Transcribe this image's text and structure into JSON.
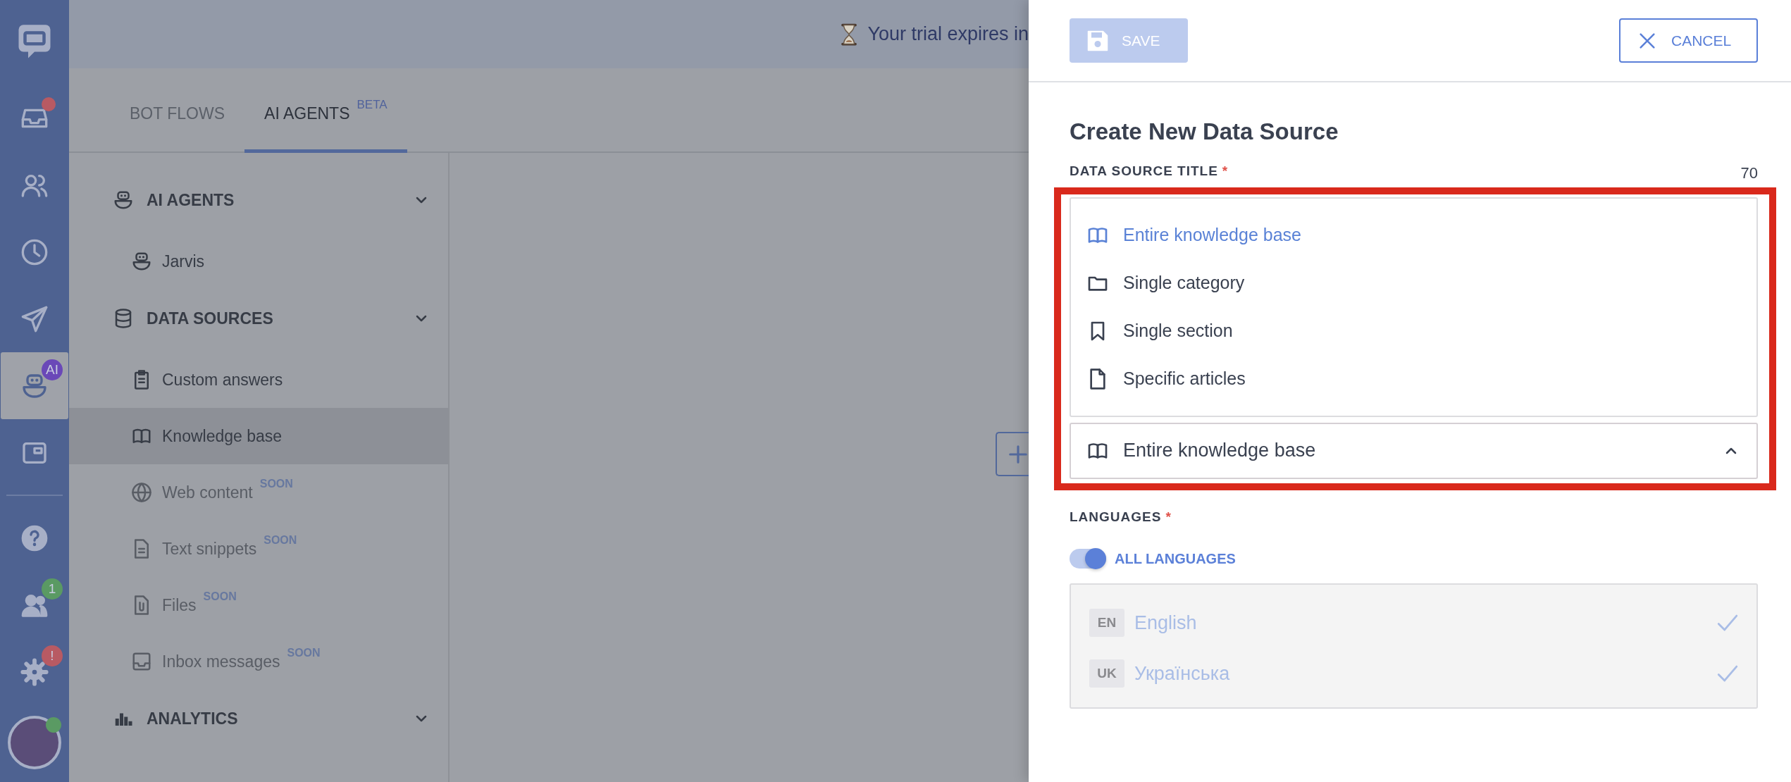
{
  "rail": {
    "top": [
      {
        "selected": false,
        "badge": {
          "color": "#b85a63"
        }
      },
      {
        "selected": false
      },
      {
        "selected": false
      },
      {
        "selected": false
      },
      {
        "selected": true,
        "badge": {
          "text": "AI",
          "color": "#6a48b8"
        }
      },
      {
        "selected": false
      }
    ],
    "bottom": [
      {
        "selected": false
      },
      {
        "selected": false,
        "badge": {
          "text": "1",
          "color": "#5a9a63"
        }
      },
      {
        "selected": false,
        "badge": {
          "text": "!",
          "color": "#b85a63"
        }
      }
    ],
    "avatar": {
      "online": true
    }
  },
  "top_bar": {
    "trial_text": "Your trial expires in"
  },
  "tabs": [
    {
      "label": "BOT FLOWS",
      "selected": false
    },
    {
      "label": "AI AGENTS",
      "badge": "BETA",
      "selected": true
    }
  ],
  "nav": {
    "sections": [
      {
        "title": "AI AGENTS",
        "items": [
          {
            "label": "Jarvis",
            "selected": false,
            "disabled": false
          }
        ]
      },
      {
        "title": "DATA SOURCES",
        "items": [
          {
            "label": "Custom answers",
            "selected": false,
            "disabled": false
          },
          {
            "label": "Knowledge base",
            "selected": true,
            "disabled": false
          },
          {
            "label": "Web content",
            "soon": "SOON",
            "selected": false,
            "disabled": true
          },
          {
            "label": "Text snippets",
            "soon": "SOON",
            "selected": false,
            "disabled": true
          },
          {
            "label": "Files",
            "soon": "SOON",
            "selected": false,
            "disabled": true
          },
          {
            "label": "Inbox messages",
            "soon": "SOON",
            "selected": false,
            "disabled": true
          }
        ]
      },
      {
        "title": "ANALYTICS"
      }
    ]
  },
  "panel": {
    "save_button": {
      "label": "SAVE",
      "disabled": true
    },
    "cancel_button": {
      "label": "CANCEL"
    },
    "title": "Create New Data Source",
    "title_field": {
      "label": "DATA SOURCE TITLE",
      "required_mark": "*",
      "counter": "70"
    },
    "scope_menu": {
      "options": [
        {
          "label": "Entire knowledge base",
          "selected": true
        },
        {
          "label": "Single category",
          "selected": false
        },
        {
          "label": "Single section",
          "selected": false
        },
        {
          "label": "Specific articles",
          "selected": false
        }
      ]
    },
    "scope_select": {
      "value": "Entire knowledge base",
      "expanded": true
    },
    "languages": {
      "label": "LANGUAGES",
      "required_mark": "*",
      "all_toggle": {
        "label": "ALL LANGUAGES",
        "on": true
      },
      "items": [
        {
          "code": "EN",
          "name": "English",
          "checked": true,
          "disabled": true
        },
        {
          "code": "UK",
          "name": "Українська",
          "checked": true,
          "disabled": true
        }
      ]
    }
  }
}
